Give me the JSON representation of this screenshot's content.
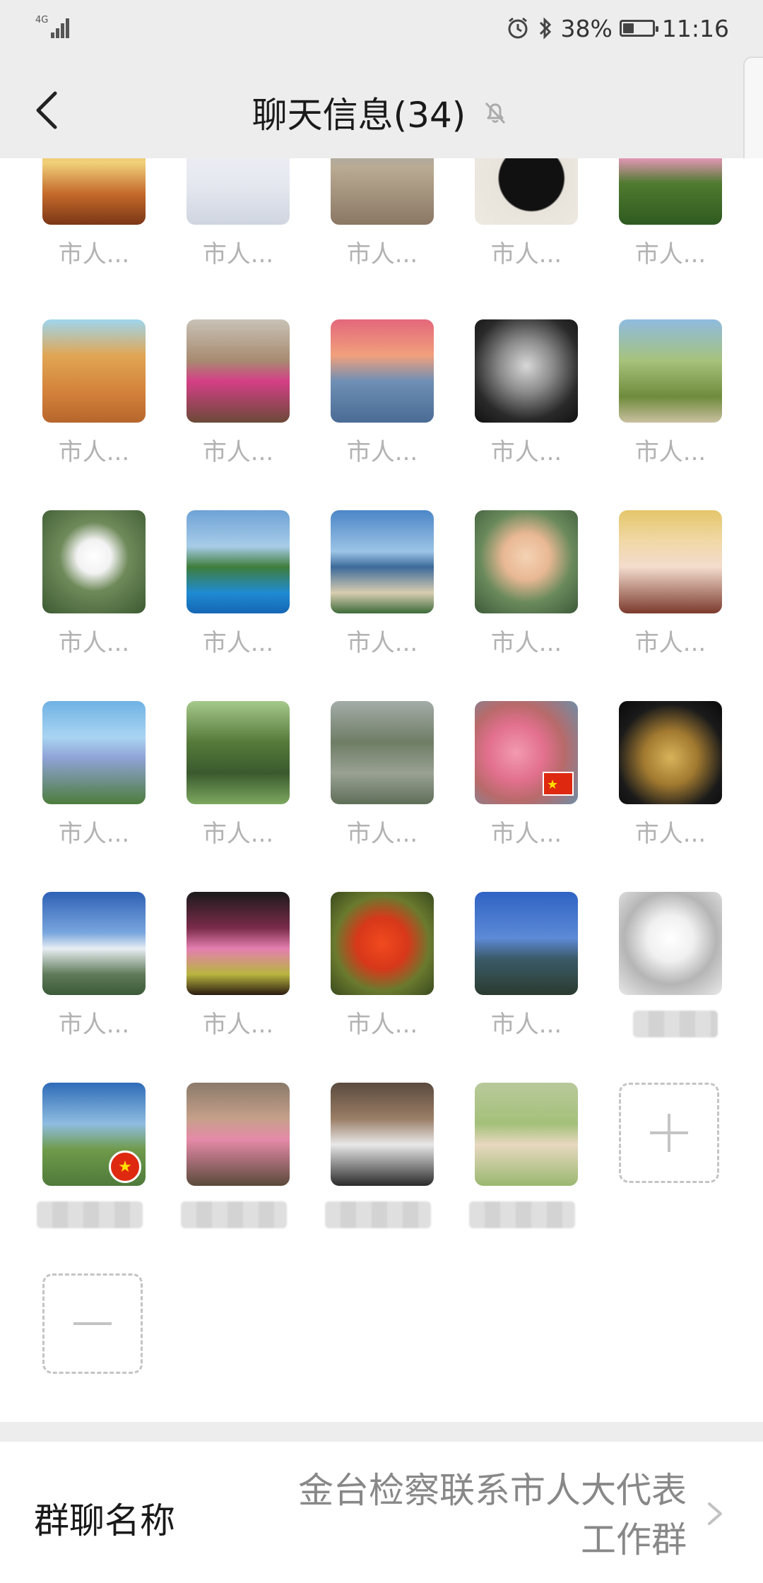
{
  "status_bar": {
    "network": "4G",
    "battery_text": "38%",
    "battery_level": 0.38,
    "time": "11:16"
  },
  "nav": {
    "title": "聊天信息(34)"
  },
  "members": [
    {
      "name": "市人...",
      "bg": "linear-gradient(180deg,#e8b14c 0%,#f0d07a 40%,#c56a2a 70%,#7a3716 100%)"
    },
    {
      "name": "市人...",
      "bg": "linear-gradient(180deg,#f4f4f8 0%,#e6e8f0 60%,#cfd5e0 100%)"
    },
    {
      "name": "市人...",
      "bg": "linear-gradient(180deg,#8fa8c4 0%,#b9aa92 45%,#8a7764 100%)"
    },
    {
      "name": "市人...",
      "bg": "radial-gradient(circle at 55% 55%,#111 0%,#111 40%,#e8e4dc 42%,#efeae2 100%)"
    },
    {
      "name": "市人...",
      "bg": "linear-gradient(180deg,#5b8a3a 0%,#e597b8 35%,#4f7a2f 60%,#2f5a20 100%)"
    },
    {
      "name": "市人...",
      "bg": "linear-gradient(180deg,#9fd6ee 0%,#e0a653 35%,#d4823b 70%,#b7662c 100%)"
    },
    {
      "name": "市人...",
      "bg": "linear-gradient(180deg,#c8c2b6 0%,#a88a70 40%,#d43f86 60%,#6b4a38 100%)"
    },
    {
      "name": "市人...",
      "bg": "linear-gradient(180deg,#e4677b 0%,#f0a07c 35%,#6f8fb4 60%,#4a6c94 100%)"
    },
    {
      "name": "市人...",
      "bg": "radial-gradient(circle at 50% 45%,#d8d8d8 0%,#8a8a8a 35%,#2a2a2a 70%,#111 100%)"
    },
    {
      "name": "市人...",
      "bg": "linear-gradient(180deg,#8fbbe0 0%,#a6c27c 40%,#6f8b3c 75%,#c9c0a0 100%)"
    },
    {
      "name": "市人...",
      "bg": "radial-gradient(circle at 50% 45%,#ffffff 0%,#f2f2f2 22%,#6f8a5a 45%,#3c5a32 100%)"
    },
    {
      "name": "市人...",
      "bg": "linear-gradient(180deg,#6ea2d6 0%,#a7cce8 35%,#3f7d3b 55%,#1f8bd2 80%,#1566b3 100%)"
    },
    {
      "name": "市人...",
      "bg": "linear-gradient(180deg,#4b86c7 0%,#9cc4e6 40%,#3c6a9a 55%,#d8cdb0 80%,#3d6a3a 100%)"
    },
    {
      "name": "市人...",
      "bg": "radial-gradient(circle at 50% 45%,#f4d3b4 0%,#e9b894 30%,#6a8a5c 60%,#3e5a3a 100%)"
    },
    {
      "name": "市人...",
      "bg": "linear-gradient(180deg,#e4c66a 0%,#f1d8a6 30%,#f3dccd 55%,#7b3a2d 100%)"
    },
    {
      "name": "市人...",
      "bg": "linear-gradient(180deg,#6fb2e4 0%,#a9d4f2 35%,#8fa3d6 55%,#4d7d3c 100%)"
    },
    {
      "name": "市人...",
      "bg": "linear-gradient(180deg,#a6c98c 0%,#557a3a 40%,#3a5a2e 70%,#7da85f 100%)"
    },
    {
      "name": "市人...",
      "bg": "linear-gradient(180deg,#a4aca8 0%,#6f7d66 40%,#99a193 70%,#5f6e58 100%)"
    },
    {
      "name": "市人...",
      "bg": "radial-gradient(circle at 40% 50%,#f29ab0 0%,#e2708e 35%,#b86a6a 60%,#6f8ea6 100%)"
    },
    {
      "name": "市人...",
      "bg": "radial-gradient(circle at 50% 55%,#d8b35a 0%,#a27a30 35%,#1a1a1a 70%,#0a0a0a 100%)"
    },
    {
      "name": "市人...",
      "bg": "linear-gradient(180deg,#2e61b5 0%,#7aa6de 40%,#e8eef4 55%,#5f7a58 80%,#3b5a38 100%)"
    },
    {
      "name": "市人...",
      "bg": "linear-gradient(180deg,#1a1a1a 0%,#7b2b4a 35%,#e47fb0 55%,#b8b53f 80%,#2a1a10 100%)"
    },
    {
      "name": "市人...",
      "bg": "radial-gradient(circle at 50% 50%,#f04a1e 0%,#d8381a 35%,#6a7a2e 65%,#3a4a1e 100%)"
    },
    {
      "name": "市人...",
      "bg": "linear-gradient(180deg,#2f63c4 0%,#5d8ad6 45%,#3a5a68 65%,#2b3b2f 100%)"
    },
    {
      "name": "",
      "bg": "radial-gradient(circle at 50% 45%,#ffffff 0%,#f0f0f0 30%,#b5b5b5 60%,#e8e8e8 100%)"
    },
    {
      "name": "",
      "bg": "linear-gradient(180deg,#2e6bb8 0%,#8fbde0 40%,#6f9a4a 65%,#4f7a3a 100%)"
    },
    {
      "name": "",
      "bg": "linear-gradient(180deg,#8a7a6a 0%,#c6a08a 35%,#e58aa8 55%,#5a4a3a 100%)"
    },
    {
      "name": "",
      "bg": "linear-gradient(180deg,#5a4a3e 0%,#9a7e66 35%,#e8e8e8 60%,#2a2a2a 100%)"
    },
    {
      "name": "",
      "bg": "linear-gradient(180deg,#b8c99a 0%,#a4c07a 40%,#e8d8c0 60%,#9ab870 100%)"
    }
  ],
  "group": {
    "label": "群聊名称",
    "value_line1": "金台检察联系市人大代表",
    "value_line2": "工作群"
  }
}
